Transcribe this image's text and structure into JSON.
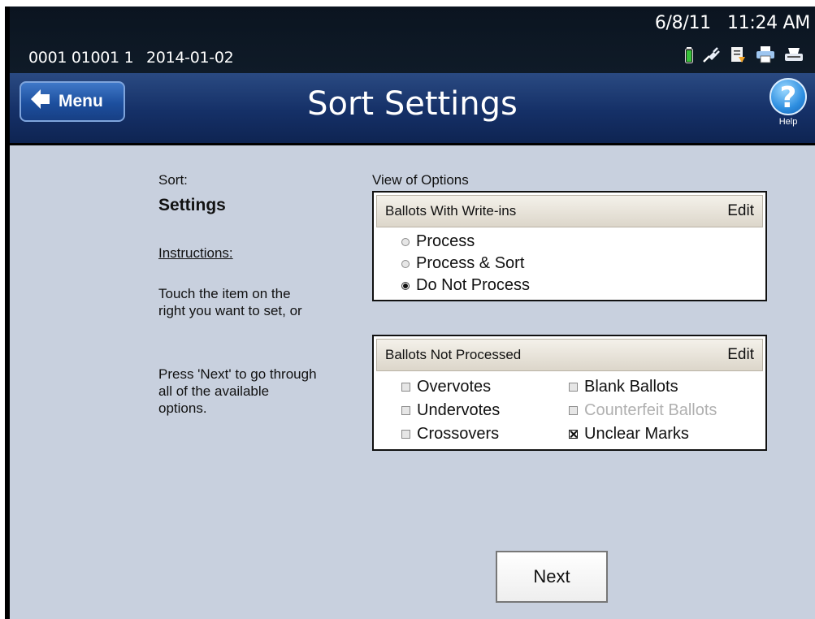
{
  "status_bar": {
    "machine_id": "0001 01001 1",
    "machine_date": "2014-01-02",
    "date": "6/8/11",
    "time": "11:24 AM",
    "icons": [
      "battery-icon",
      "power-plug-icon",
      "document-icon",
      "printer-icon",
      "scanner-icon"
    ]
  },
  "header": {
    "menu_label": "Menu",
    "title": "Sort Settings",
    "help_label": "Help"
  },
  "left": {
    "sort_label": "Sort:",
    "heading": "Settings",
    "instructions_heading": "Instructions:",
    "instruction_1": "Touch the item on the right you want to set, or",
    "instruction_2": "Press 'Next' to go through all of the available options."
  },
  "view_label": "View of Options",
  "write_ins": {
    "title": "Ballots With Write-ins",
    "edit_label": "Edit",
    "options": [
      {
        "label": "Process",
        "selected": false
      },
      {
        "label": "Process & Sort",
        "selected": false
      },
      {
        "label": "Do Not Process",
        "selected": true
      }
    ]
  },
  "not_processed": {
    "title": "Ballots Not Processed",
    "edit_label": "Edit",
    "options": [
      {
        "label": "Overvotes",
        "checked": false,
        "disabled": false
      },
      {
        "label": "Blank Ballots",
        "checked": false,
        "disabled": false
      },
      {
        "label": "Undervotes",
        "checked": false,
        "disabled": false
      },
      {
        "label": "Counterfeit Ballots",
        "checked": false,
        "disabled": true
      },
      {
        "label": "Crossovers",
        "checked": false,
        "disabled": false
      },
      {
        "label": "Unclear Marks",
        "checked": true,
        "disabled": false
      }
    ]
  },
  "next_label": "Next",
  "colors": {
    "title_bar": "#153067",
    "menu_button": "#1d4f9e",
    "content_bg": "#c8d0de",
    "help_icon": "#2d8ee0"
  }
}
